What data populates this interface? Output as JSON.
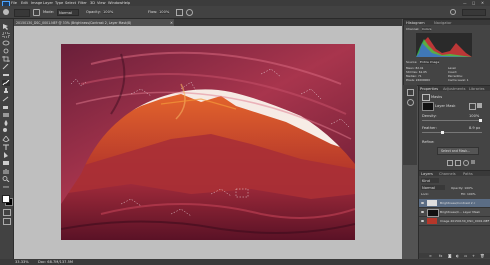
{
  "app": {
    "menus": [
      "File",
      "Edit",
      "Image",
      "Layer",
      "Type",
      "Select",
      "Filter",
      "3D",
      "View",
      "Window",
      "Help"
    ]
  },
  "options": {
    "blend_label": "Mode:",
    "blend_value": "Normal",
    "opacity_label": "Opacity:",
    "opacity_value": "100%",
    "flow_label": "Flow:",
    "flow_value": "100%"
  },
  "document": {
    "tab_title": "20150130_DSC_0001.NEF @ 33% (Brightness/Contrast 2, Layer Mask/8)"
  },
  "histogram": {
    "tab_histogram": "Histogram",
    "tab_navigator": "Navigator",
    "channel_label": "Channel:",
    "channel_value": "Colors",
    "source_label": "Source:",
    "source_value": "Entire Image",
    "stats_left": [
      "Mean: 82.41",
      "Std Dev: 61.05",
      "Median: 71",
      "Pixels: 24000000"
    ],
    "stats_right": [
      "Level:",
      "Count:",
      "Percentile:",
      "Cache Level: 1"
    ]
  },
  "properties": {
    "tab_properties": "Properties",
    "tab_adjustments": "Adjustments",
    "tab_libraries": "Libraries",
    "title": "Masks",
    "mask_label": "Layer Mask",
    "density_label": "Density:",
    "density_value": "100%",
    "feather_label": "Feather:",
    "feather_value": "8.9 px",
    "refine_label": "Refine:",
    "button_label": "Select and Mask...",
    "density_level": 1.0,
    "feather_level": 0.34
  },
  "layers": {
    "tab_layers": "Layers",
    "tab_channels": "Channels",
    "tab_paths": "Paths",
    "kind_label": "Kind",
    "blend_value": "Normal",
    "opacity_label": "Opacity: 100%",
    "fill_label": "Fill: 100%",
    "lock_label": "Lock:",
    "items": [
      {
        "name": "Brightness/Contrast 2 c",
        "selected": true
      },
      {
        "name": "Brightness/C... Layer Mask",
        "selected": false
      },
      {
        "name": "Image 20150130_DSC_0001.NEF",
        "selected": false
      }
    ]
  },
  "status": {
    "zoom": "33.33%",
    "doc": "Doc: 68.7M/137.5M"
  },
  "colors": {
    "accent": "#5b6d85",
    "red_layer": "#b5372a"
  }
}
